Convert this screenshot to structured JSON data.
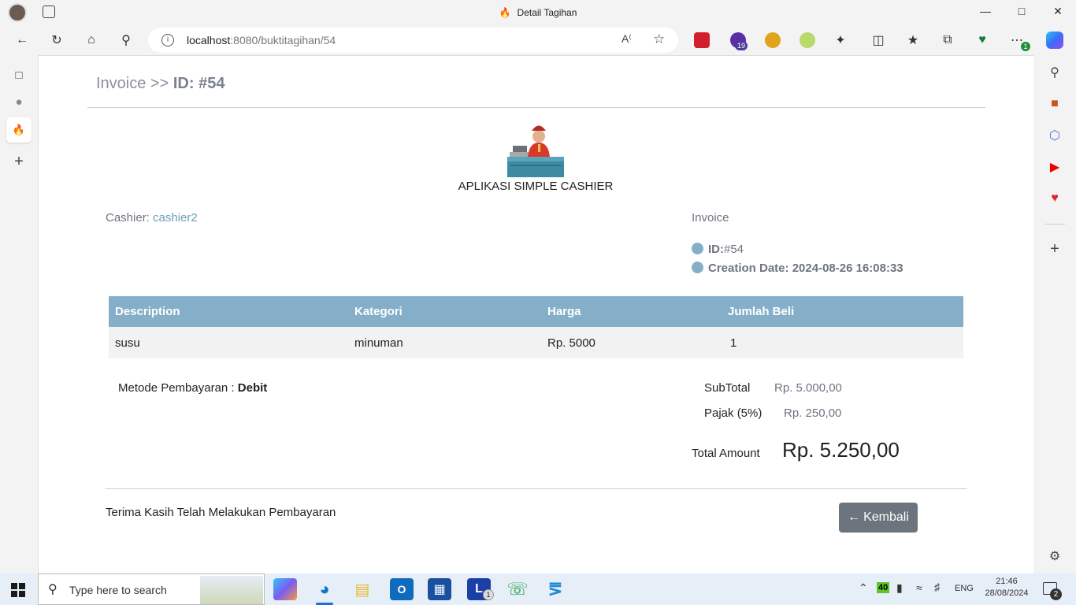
{
  "browser": {
    "tab_title": "Detail Tagihan",
    "url_host": "localhost",
    "url_rest": ":8080/buktitagihan/54",
    "extension_badge_1": "19",
    "extension_badge_2": "1"
  },
  "header": {
    "breadcrumb_prefix": "Invoice >>",
    "breadcrumb_id": "ID: #54"
  },
  "app": {
    "name": "APLIKASI SIMPLE CASHIER"
  },
  "cashier": {
    "label": "Cashier:",
    "name": "cashier2"
  },
  "invoice": {
    "title": "Invoice",
    "id_label": "ID:",
    "id_value": "#54",
    "date_label": "Creation Date:",
    "date_value": "2024-08-26 16:08:33"
  },
  "table": {
    "headers": [
      "Description",
      "Kategori",
      "Harga",
      "Jumlah Beli"
    ],
    "rows": [
      [
        "susu",
        "minuman",
        "Rp. 5000",
        "1"
      ]
    ]
  },
  "payment": {
    "method_label": "Metode Pembayaran :",
    "method_value": "Debit"
  },
  "summary": {
    "subtotal_label": "SubTotal",
    "subtotal_value": "Rp. 5.000,00",
    "tax_label": "Pajak (5%)",
    "tax_value": "Rp. 250,00",
    "total_label": "Total Amount",
    "total_value": "Rp. 5.250,00"
  },
  "footer": {
    "thanks": "Terima Kasih Telah Melakukan Pembayaran",
    "back_label": "Kembali"
  },
  "taskbar": {
    "search_placeholder": "Type here to search",
    "battery_badge": "40",
    "language": "ENG",
    "time": "21:46",
    "date": "28/08/2024",
    "notification_count": "2",
    "app_badge": "1"
  },
  "colors": {
    "accent": "#85afc9",
    "button": "#6c757d"
  }
}
